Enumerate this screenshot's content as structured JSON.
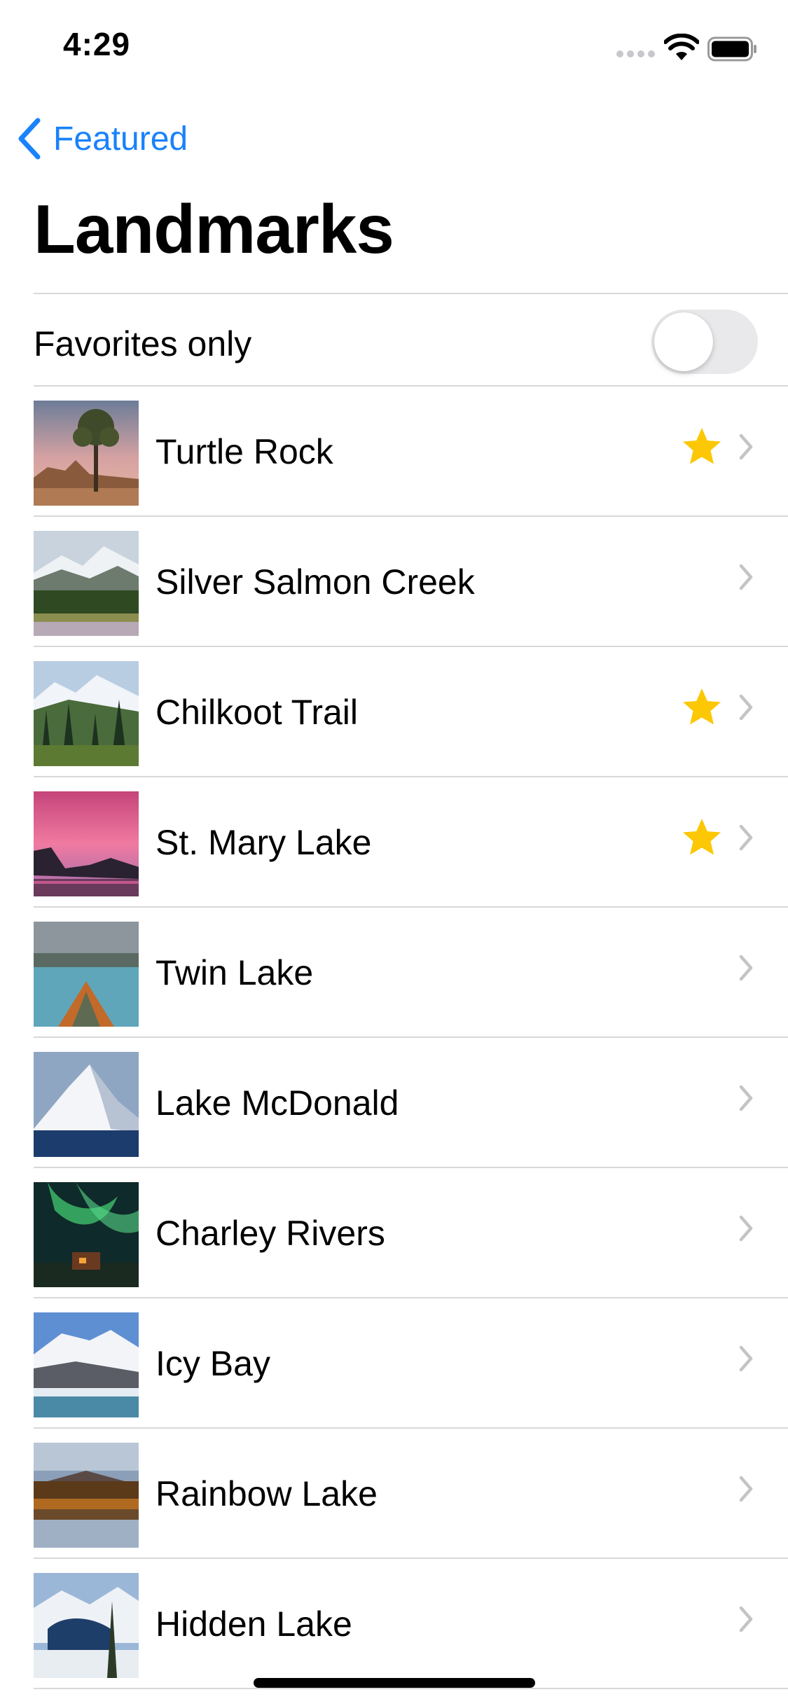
{
  "status_bar": {
    "time": "4:29"
  },
  "nav": {
    "back_label": "Featured",
    "title": "Landmarks"
  },
  "filter": {
    "label": "Favorites only",
    "on": false
  },
  "colors": {
    "accent": "#1a82fb",
    "star": "#fcc704",
    "chevron": "#c4c4c7"
  },
  "landmarks": [
    {
      "name": "Turtle Rock",
      "favorite": true
    },
    {
      "name": "Silver Salmon Creek",
      "favorite": false
    },
    {
      "name": "Chilkoot Trail",
      "favorite": true
    },
    {
      "name": "St. Mary Lake",
      "favorite": true
    },
    {
      "name": "Twin Lake",
      "favorite": false
    },
    {
      "name": "Lake McDonald",
      "favorite": false
    },
    {
      "name": "Charley Rivers",
      "favorite": false
    },
    {
      "name": "Icy Bay",
      "favorite": false
    },
    {
      "name": "Rainbow Lake",
      "favorite": false
    },
    {
      "name": "Hidden Lake",
      "favorite": false
    }
  ]
}
